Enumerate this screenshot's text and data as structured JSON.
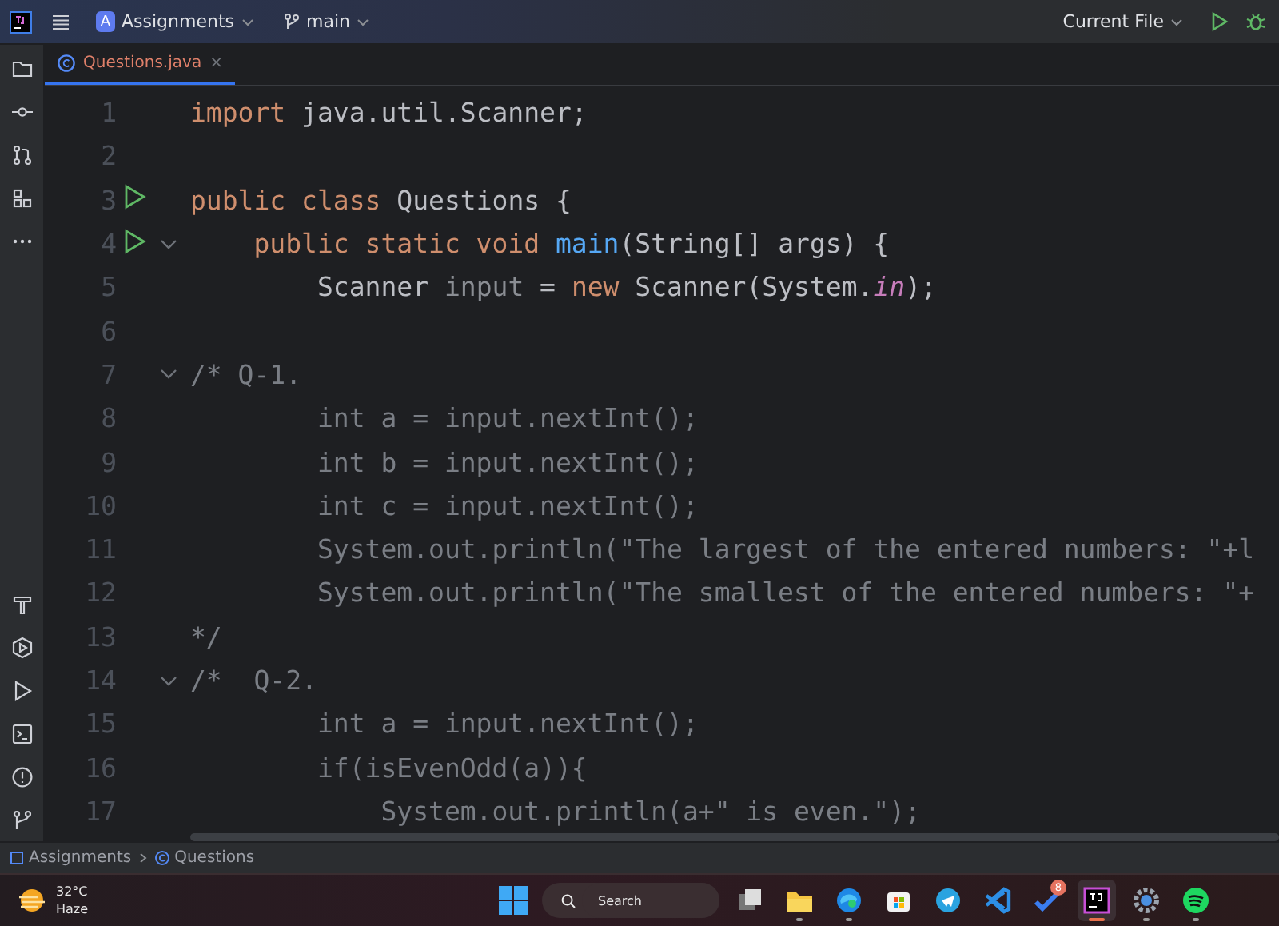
{
  "title_bar": {
    "project": {
      "badge": "A",
      "name": "Assignments"
    },
    "branch": "main",
    "run_config": "Current File"
  },
  "tabs": [
    {
      "label": "Questions.java",
      "selected": true,
      "has_errors": true,
      "close": "×"
    }
  ],
  "editor": {
    "lines": [
      {
        "number": "1",
        "run": false,
        "fold": false,
        "tokens": [
          {
            "kind": "keyword",
            "text": "import"
          },
          {
            "kind": "plain",
            "text": " java.util.Scanner;"
          }
        ]
      },
      {
        "number": "2",
        "run": false,
        "fold": false
      },
      {
        "number": "3",
        "run": true,
        "fold": false,
        "tokens": [
          {
            "kind": "keyword",
            "text": "public class"
          },
          {
            "kind": "plain",
            "text": " Questions {"
          }
        ]
      },
      {
        "number": "4",
        "run": true,
        "fold": true,
        "tokens": [
          {
            "kind": "keyword",
            "text": "    public static void "
          },
          {
            "kind": "method",
            "text": "main"
          },
          {
            "kind": "plain",
            "text": "(String[] args) {"
          }
        ]
      },
      {
        "number": "5",
        "run": false,
        "fold": false,
        "tokens": [
          {
            "kind": "plain",
            "text": "        Scanner "
          },
          {
            "kind": "unused",
            "text": "input"
          },
          {
            "kind": "plain",
            "text": " = "
          },
          {
            "kind": "keyword",
            "text": "new"
          },
          {
            "kind": "plain",
            "text": " Scanner(System."
          },
          {
            "kind": "static",
            "text": "in"
          },
          {
            "kind": "plain",
            "text": ");"
          }
        ]
      },
      {
        "number": "6",
        "run": false,
        "fold": false
      },
      {
        "number": "7",
        "run": false,
        "fold": true,
        "tokens": [
          {
            "kind": "comment",
            "text": "/* Q-1."
          }
        ]
      },
      {
        "number": "8",
        "run": false,
        "fold": false,
        "tokens": [
          {
            "kind": "comment",
            "text": "        int a = input.nextInt();"
          }
        ]
      },
      {
        "number": "9",
        "run": false,
        "fold": false,
        "tokens": [
          {
            "kind": "comment",
            "text": "        int b = input.nextInt();"
          }
        ]
      },
      {
        "number": "10",
        "run": false,
        "fold": false,
        "tokens": [
          {
            "kind": "comment",
            "text": "        int c = input.nextInt();"
          }
        ]
      },
      {
        "number": "11",
        "run": false,
        "fold": false,
        "tokens": [
          {
            "kind": "comment",
            "text": "        System.out.println(\"The largest of the entered numbers: \"+l"
          }
        ]
      },
      {
        "number": "12",
        "run": false,
        "fold": false,
        "tokens": [
          {
            "kind": "comment",
            "text": "        System.out.println(\"The smallest of the entered numbers: \"+"
          }
        ]
      },
      {
        "number": "13",
        "run": false,
        "fold": false,
        "tokens": [
          {
            "kind": "comment",
            "text": "*/"
          }
        ]
      },
      {
        "number": "14",
        "run": false,
        "fold": true,
        "tokens": [
          {
            "kind": "comment",
            "text": "/*  Q-2."
          }
        ]
      },
      {
        "number": "15",
        "run": false,
        "fold": false,
        "tokens": [
          {
            "kind": "comment",
            "text": "        int a = input.nextInt();"
          }
        ]
      },
      {
        "number": "16",
        "run": false,
        "fold": false,
        "tokens": [
          {
            "kind": "comment",
            "text": "        if(isEvenOdd(a)){"
          }
        ]
      },
      {
        "number": "17",
        "run": false,
        "fold": false,
        "tokens": [
          {
            "kind": "comment",
            "text": "            System.out.println(a+\" is even.\");"
          }
        ]
      }
    ]
  },
  "breadcrumbs": [
    {
      "kind": "module",
      "text": "Assignments"
    },
    {
      "kind": "class",
      "text": "Questions"
    }
  ],
  "taskbar": {
    "weather": {
      "temperature": "32°C",
      "condition": "Haze"
    },
    "search": {
      "placeholder": "Search"
    },
    "apps": [
      {
        "kind": "task-view",
        "running": false,
        "active": false
      },
      {
        "kind": "folder",
        "running": true,
        "active": false
      },
      {
        "kind": "browser",
        "running": true,
        "active": false
      },
      {
        "kind": "store",
        "running": false,
        "active": false
      },
      {
        "kind": "telegram",
        "running": false,
        "active": false
      },
      {
        "kind": "vscode",
        "running": false,
        "active": false
      },
      {
        "kind": "todo",
        "running": false,
        "active": false,
        "badge": "8"
      },
      {
        "kind": "ide",
        "running": true,
        "active": true
      },
      {
        "kind": "gear",
        "running": true,
        "active": false
      },
      {
        "kind": "spotify",
        "running": true,
        "active": false
      }
    ]
  }
}
